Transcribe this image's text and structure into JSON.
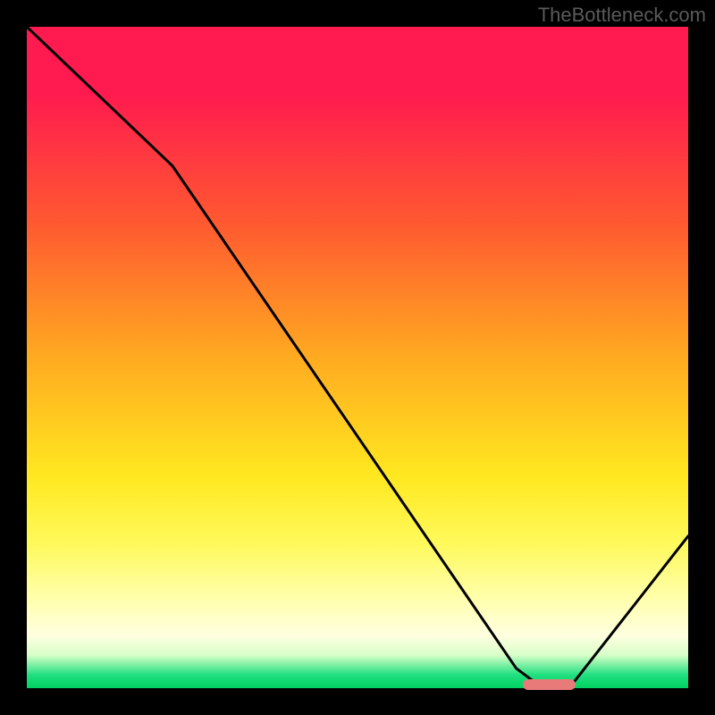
{
  "watermark": "TheBottleneck.com",
  "chart_data": {
    "type": "line",
    "title": "",
    "xlabel": "",
    "ylabel": "",
    "xlim": [
      0,
      100
    ],
    "ylim": [
      0,
      100
    ],
    "curve": {
      "x": [
        0,
        22,
        74,
        78,
        82,
        100
      ],
      "y": [
        100,
        79,
        3,
        0,
        0,
        23
      ]
    },
    "marker": {
      "x_start": 75,
      "x_end": 83,
      "y": 0
    },
    "gradient_stops": [
      {
        "pos": 0,
        "color": "#ff1a4f"
      },
      {
        "pos": 50,
        "color": "#ffaa20"
      },
      {
        "pos": 80,
        "color": "#ffff80"
      },
      {
        "pos": 100,
        "color": "#00d060"
      }
    ]
  }
}
